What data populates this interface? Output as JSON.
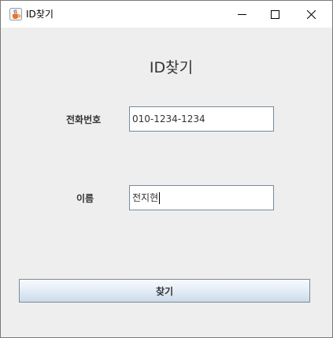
{
  "window": {
    "title": "ID찾기",
    "app_icon": "java-coffee-cup-icon",
    "controls": {
      "minimize_icon": "minimize-icon",
      "maximize_icon": "maximize-icon",
      "close_icon": "close-icon"
    }
  },
  "form": {
    "heading": "ID찾기",
    "phone": {
      "label": "전화번호",
      "value": "010-1234-1234"
    },
    "name": {
      "label": "이름",
      "value": "전지현"
    },
    "find_button_label": "찾기"
  },
  "colors": {
    "background": "#eeeeee",
    "titlebar": "#ffffff",
    "field_border": "#7a8a99",
    "button_gradient_top": "#f8fbfe",
    "button_gradient_bottom": "#cddbea"
  }
}
